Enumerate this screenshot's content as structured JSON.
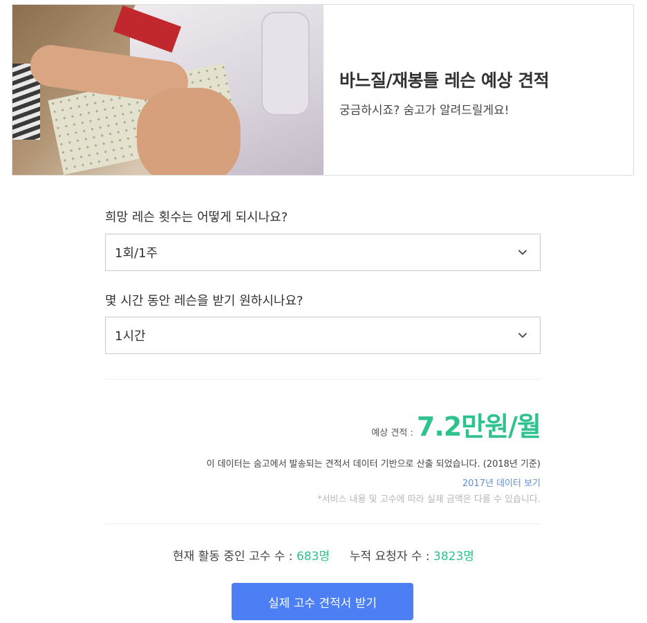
{
  "banner": {
    "title": "바느질/재봉틀 레슨 예상 견적",
    "subtitle": "궁금하시죠? 숨고가 알려드릴게요!"
  },
  "questions": [
    {
      "label": "희망 레슨 횟수는 어떻게 되시나요?",
      "selected": "1회/1주"
    },
    {
      "label": "몇 시간 동안 레슨을 받기 원하시나요?",
      "selected": "1시간"
    }
  ],
  "estimate": {
    "label": "예상 견적 :",
    "value": "7.2만원/월",
    "note": "이 데이터는 숨고에서 발송되는 견적서 데이터 기반으로 산출 되었습니다. (2018년 기준)",
    "prev_data_link": "2017년 데이터 보기",
    "disclaimer": "*서비스 내용 및 고수에 따라 실제 금액은 다를 수 있습니다."
  },
  "stats": {
    "active_label": "현재 활동 중인 고수 수 :",
    "active_value": "683명",
    "requesters_label": "누적 요청자 수 :",
    "requesters_value": "3823명"
  },
  "cta": {
    "label": "실제 고수 견적서 받기"
  },
  "colors": {
    "accent_green": "#2ec28c",
    "link_blue": "#5b8fd6",
    "button_blue": "#4b7ff3"
  },
  "icons": {
    "select_arrow": "chevron-down-icon"
  }
}
